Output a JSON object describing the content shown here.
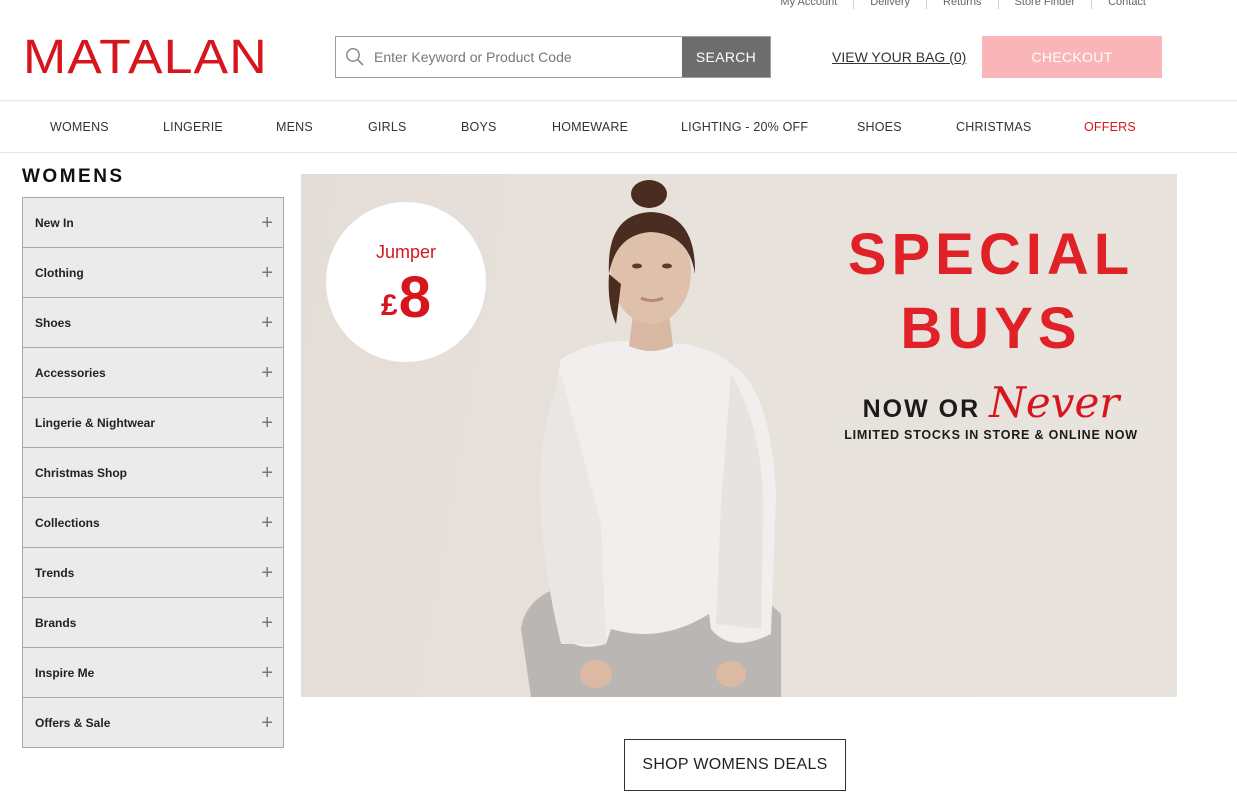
{
  "utility_links": [
    "My Account",
    "Delivery",
    "Returns",
    "Store Finder",
    "Contact"
  ],
  "header": {
    "logo": "MATALAN",
    "search_placeholder": "Enter Keyword or Product Code",
    "search_button": "SEARCH",
    "bag_link": "VIEW YOUR BAG (0)",
    "checkout_button": "CHECKOUT"
  },
  "nav": [
    "WOMENS",
    "LINGERIE",
    "MENS",
    "GIRLS",
    "BOYS",
    "HOMEWARE",
    "LIGHTING - 20% OFF",
    "SHOES",
    "CHRISTMAS",
    "OFFERS"
  ],
  "sidebar": {
    "title": "WOMENS",
    "items": [
      {
        "label": "New In"
      },
      {
        "label": "Clothing"
      },
      {
        "label": "Shoes"
      },
      {
        "label": "Accessories"
      },
      {
        "label": "Lingerie & Nightwear"
      },
      {
        "label": "Christmas Shop"
      },
      {
        "label": "Collections"
      },
      {
        "label": "Trends"
      },
      {
        "label": "Brands"
      },
      {
        "label": "Inspire Me"
      },
      {
        "label": "Offers & Sale"
      }
    ],
    "expand_symbol": "+"
  },
  "banner": {
    "price_label": "Jumper",
    "price_currency": "£",
    "price_value": "8",
    "headline_1": "SPECIAL",
    "headline_2": "BUYS",
    "now_or": "NOW OR",
    "never": "Never",
    "subline": "LIMITED STOCKS IN STORE & ONLINE NOW"
  },
  "cta": "SHOP WOMENS DEALS",
  "colors": {
    "brand_red": "#d6151d",
    "checkout_pink": "#f9b5b7",
    "search_button_grey": "#6d6d6d",
    "sidebar_bg": "#ebebeb"
  }
}
